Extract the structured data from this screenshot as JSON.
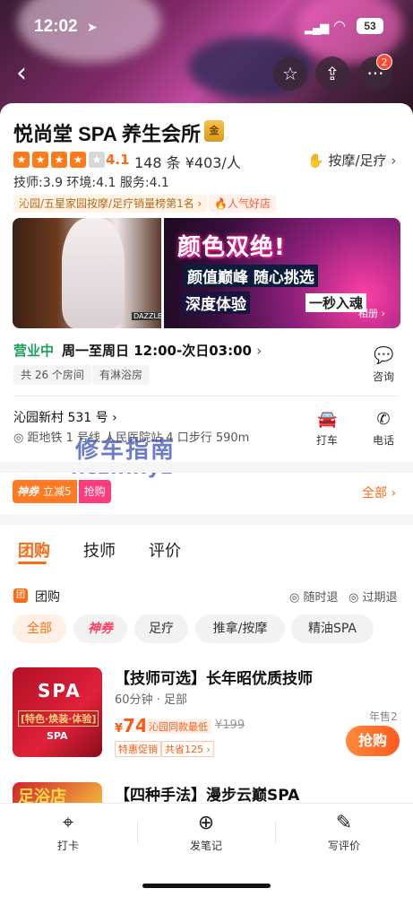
{
  "status_bar": {
    "time": "12:02",
    "location_icon": "location-arrow-icon",
    "battery": "53"
  },
  "nav": {
    "back_icon": "back-chevron-icon",
    "star_icon": "star-outline-icon",
    "share_icon": "share-icon",
    "more_icon": "more-dots-icon",
    "more_badge": "2"
  },
  "shop": {
    "name": "悦尚堂 SPA 养生会所",
    "level_badge": "金",
    "rating": "4.1",
    "rating_stars": 4,
    "review_summary": "148 条 ¥403/人",
    "category": "按摩/足疗",
    "sub_scores": "技师:3.9  环境:4.1  服务:4.1",
    "rank_tag": "沁园/五星家园按摩/足疗销量榜第1名",
    "hot_tag": "人气好店"
  },
  "photos": {
    "photo1_tag": "DAZZLE",
    "photo2_line1": "颜色双绝!",
    "photo2_line2": "颜值巅峰 随心挑选",
    "photo2_line3": "深度体验",
    "photo2_line4": "一秒入魂",
    "album_label": "相册"
  },
  "hours": {
    "status": "营业中",
    "text": "周一至周日 12:00-次日03:00"
  },
  "facilities": [
    "共 26 个房间",
    "有淋浴房"
  ],
  "actions": {
    "consult": "咨询",
    "taxi": "打车",
    "phone": "电话"
  },
  "address": {
    "street": "沁园新村 531 号",
    "distance": "距地铁 1 号线 人民医院站 4 口步行 590m"
  },
  "watermark": {
    "line1": "修车指南",
    "line2": "xczn.xyz"
  },
  "coupon": {
    "tag": "神券",
    "discount": "立减5",
    "action": "抢购",
    "all": "全部"
  },
  "tabs": [
    "团购",
    "技师",
    "评价"
  ],
  "group_buy": {
    "icon": "团",
    "label": "团购",
    "opt1": "随时退",
    "opt2": "过期退"
  },
  "filters": [
    "全部",
    "神券",
    "足疗",
    "推拿/按摩",
    "精油SPA"
  ],
  "deals": [
    {
      "title": "【技师可选】长年昭优质技师",
      "sub": "60分钟 · 足部",
      "price_symbol": "¥",
      "price": "74",
      "compare": "沁园同款最低",
      "original": "¥199",
      "promo": "特惠促销",
      "saving": "共省125",
      "sold": "年售2",
      "buy": "抢购",
      "img_big": "SPA",
      "img_mid": "[特色·焕装·体验]",
      "img_sm": "SPA"
    },
    {
      "title": "【四种手法】漫步云巅SPA",
      "img_big": "足浴店"
    }
  ],
  "bottom_bar": [
    {
      "label": "打卡",
      "icon": "checkin-location-icon"
    },
    {
      "label": "发笔记",
      "icon": "camera-note-icon"
    },
    {
      "label": "写评价",
      "icon": "edit-review-icon"
    }
  ]
}
